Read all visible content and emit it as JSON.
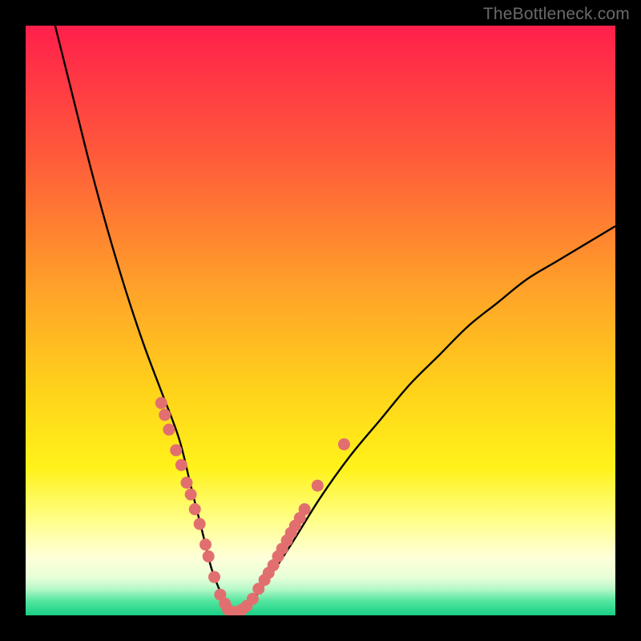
{
  "watermark": "TheBottleneck.com",
  "chart_data": {
    "type": "line",
    "title": "",
    "xlabel": "",
    "ylabel": "",
    "xlim": [
      0,
      100
    ],
    "ylim": [
      0,
      100
    ],
    "grid": false,
    "legend": false,
    "series": [
      {
        "name": "bottleneck-curve",
        "x": [
          5,
          8,
          11,
          14,
          17,
          20,
          23,
          26,
          28,
          30,
          31.5,
          33,
          34,
          35,
          36,
          38,
          41,
          45,
          50,
          55,
          60,
          65,
          70,
          75,
          80,
          85,
          90,
          95,
          100
        ],
        "y": [
          100,
          88,
          76,
          65,
          55,
          46,
          38,
          30,
          22,
          14,
          8,
          4,
          1.5,
          0.5,
          0.5,
          2,
          6,
          12,
          20,
          27,
          33,
          39,
          44,
          49,
          53,
          57,
          60,
          63,
          66
        ]
      }
    ],
    "markers": [
      {
        "x": 23.0,
        "y": 36.0
      },
      {
        "x": 23.6,
        "y": 34.0
      },
      {
        "x": 24.3,
        "y": 31.5
      },
      {
        "x": 25.5,
        "y": 28.0
      },
      {
        "x": 26.4,
        "y": 25.5
      },
      {
        "x": 27.3,
        "y": 22.5
      },
      {
        "x": 28.0,
        "y": 20.5
      },
      {
        "x": 28.7,
        "y": 18.0
      },
      {
        "x": 29.5,
        "y": 15.5
      },
      {
        "x": 30.5,
        "y": 12.0
      },
      {
        "x": 31.0,
        "y": 10.0
      },
      {
        "x": 32.0,
        "y": 6.5
      },
      {
        "x": 33.0,
        "y": 3.5
      },
      {
        "x": 33.8,
        "y": 2.0
      },
      {
        "x": 34.3,
        "y": 1.0
      },
      {
        "x": 35.0,
        "y": 0.6
      },
      {
        "x": 35.7,
        "y": 0.6
      },
      {
        "x": 36.7,
        "y": 1.0
      },
      {
        "x": 37.5,
        "y": 1.6
      },
      {
        "x": 38.5,
        "y": 2.8
      },
      {
        "x": 39.5,
        "y": 4.5
      },
      {
        "x": 40.5,
        "y": 6.0
      },
      {
        "x": 41.2,
        "y": 7.2
      },
      {
        "x": 42.0,
        "y": 8.5
      },
      {
        "x": 42.8,
        "y": 10.0
      },
      {
        "x": 43.5,
        "y": 11.3
      },
      {
        "x": 44.3,
        "y": 12.7
      },
      {
        "x": 45.0,
        "y": 14.0
      },
      {
        "x": 45.7,
        "y": 15.2
      },
      {
        "x": 46.5,
        "y": 16.5
      },
      {
        "x": 47.3,
        "y": 18.0
      },
      {
        "x": 49.5,
        "y": 22.0
      },
      {
        "x": 54.0,
        "y": 29.0
      }
    ],
    "background_gradient": {
      "stops": [
        {
          "pos": 0.0,
          "color": "#ff1f4b"
        },
        {
          "pos": 0.22,
          "color": "#ff5a3a"
        },
        {
          "pos": 0.45,
          "color": "#ffa329"
        },
        {
          "pos": 0.62,
          "color": "#ffd31a"
        },
        {
          "pos": 0.75,
          "color": "#fff21a"
        },
        {
          "pos": 0.84,
          "color": "#ffff8a"
        },
        {
          "pos": 0.9,
          "color": "#ffffd8"
        },
        {
          "pos": 0.935,
          "color": "#e8ffd8"
        },
        {
          "pos": 0.955,
          "color": "#b8f8c8"
        },
        {
          "pos": 0.975,
          "color": "#56e6a0"
        },
        {
          "pos": 1.0,
          "color": "#18cf84"
        }
      ]
    },
    "marker_color": "#e26f6f",
    "curve_color": "#000000"
  }
}
